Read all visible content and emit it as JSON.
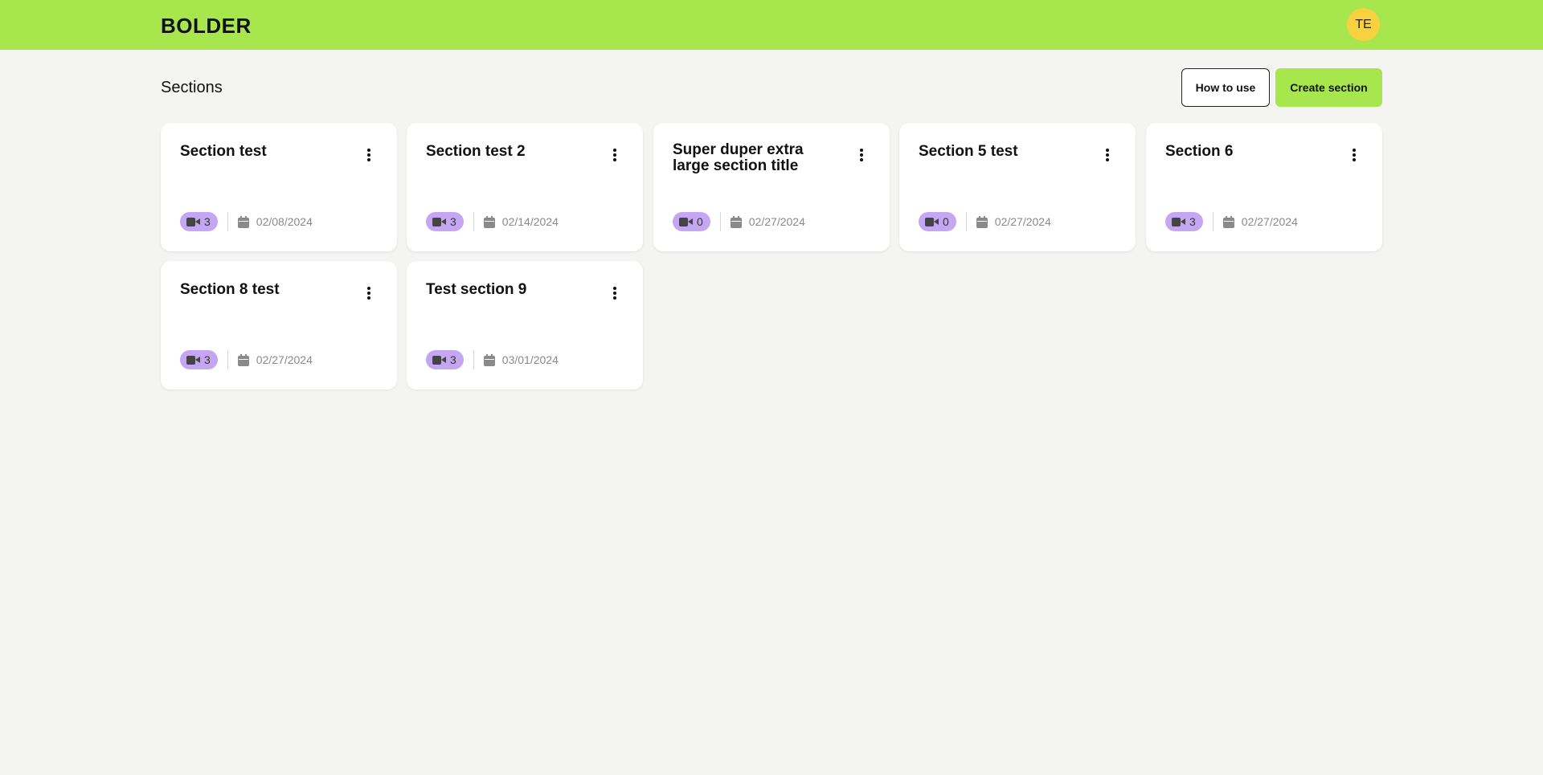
{
  "header": {
    "logo": "BOLDER",
    "avatar_initials": "TE"
  },
  "page": {
    "title": "Sections",
    "how_to_use_label": "How to use",
    "create_section_label": "Create section"
  },
  "sections": [
    {
      "title": "Section test",
      "videos": "3",
      "date": "02/08/2024"
    },
    {
      "title": "Section test 2",
      "videos": "3",
      "date": "02/14/2024"
    },
    {
      "title": "Super duper extra large section title",
      "videos": "0",
      "date": "02/27/2024"
    },
    {
      "title": "Section 5 test",
      "videos": "0",
      "date": "02/27/2024"
    },
    {
      "title": "Section 6",
      "videos": "3",
      "date": "02/27/2024"
    },
    {
      "title": "Section 8 test",
      "videos": "3",
      "date": "02/27/2024"
    },
    {
      "title": "Test section 9",
      "videos": "3",
      "date": "03/01/2024"
    }
  ],
  "colors": {
    "brand": "#a8e64e",
    "avatar": "#f7d23e",
    "video_pill": "#c5a6f2"
  },
  "icons": [
    "video-camera-icon",
    "calendar-icon",
    "kebab-menu-icon"
  ]
}
